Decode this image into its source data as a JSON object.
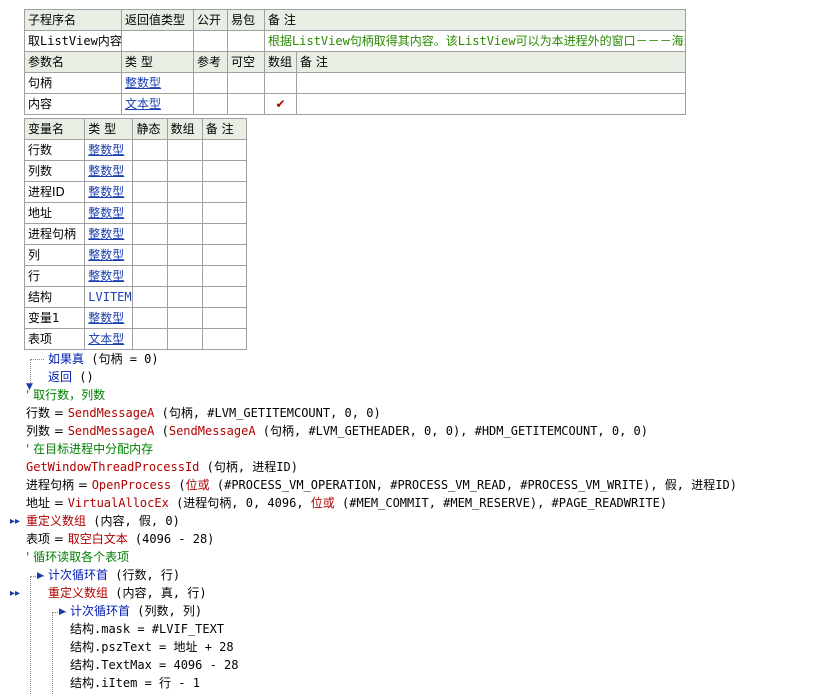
{
  "sub_table": {
    "headers": [
      "子程序名",
      "返回值类型",
      "公开",
      "易包",
      "备 注"
    ],
    "name": "取ListView内容",
    "return_type": "",
    "note": "根据ListView句柄取得其内容。该ListView可以为本进程外的窗口－－－海洋",
    "param_headers": [
      "参数名",
      "类 型",
      "参考",
      "可空",
      "数组",
      "备 注"
    ],
    "params": [
      {
        "name": "句柄",
        "type": "整数型",
        "array": ""
      },
      {
        "name": "内容",
        "type": "文本型",
        "array": "✔"
      }
    ]
  },
  "var_table": {
    "headers": [
      "变量名",
      "类 型",
      "静态",
      "数组",
      "备 注"
    ],
    "vars": [
      {
        "name": "行数",
        "type": "整数型"
      },
      {
        "name": "列数",
        "type": "整数型"
      },
      {
        "name": "进程ID",
        "type": "整数型"
      },
      {
        "name": "地址",
        "type": "整数型"
      },
      {
        "name": "进程句柄",
        "type": "整数型"
      },
      {
        "name": "列",
        "type": "整数型"
      },
      {
        "name": "行",
        "type": "整数型"
      },
      {
        "name": "结构",
        "type": "LVITEM"
      },
      {
        "name": "变量1",
        "type": "整数型"
      },
      {
        "name": "表项",
        "type": "文本型"
      }
    ]
  },
  "code": {
    "l1_kw": "如果真",
    "l1_rest": " (句柄 = 0)",
    "l2_kw": "返回",
    "l2_rest": " ()",
    "l3": "' 取行数，列数",
    "l4_a": "行数 = ",
    "l4_fn": "SendMessageA",
    "l4_rest": " (句柄, #LVM_GETITEMCOUNT, 0, 0)",
    "l5_a": "列数 = ",
    "l5_fn": "SendMessageA",
    "l5_b": " (",
    "l5_fn2": "SendMessageA",
    "l5_rest": " (句柄, #LVM_GETHEADER, 0, 0), #HDM_GETITEMCOUNT, 0, 0)",
    "l6": "' 在目标进程中分配内存",
    "l7_fn": "GetWindowThreadProcessId",
    "l7_rest": " (句柄, 进程ID)",
    "l8_a": "进程句柄 = ",
    "l8_fn": "OpenProcess",
    "l8_b": " (",
    "l8_fn2": "位或",
    "l8_rest": " (#PROCESS_VM_OPERATION, #PROCESS_VM_READ, #PROCESS_VM_WRITE), 假, 进程ID)",
    "l9_a": "地址 = ",
    "l9_fn": "VirtualAllocEx",
    "l9_b": " (进程句柄, 0, 4096, ",
    "l9_fn2": "位或",
    "l9_rest": " (#MEM_COMMIT, #MEM_RESERVE), #PAGE_READWRITE)",
    "l10_fn": "重定义数组",
    "l10_rest": " (内容, 假, 0)",
    "l11_a": "表项 = ",
    "l11_fn": "取空白文本",
    "l11_rest": " (4096 - 28)",
    "l12": "' 循环读取各个表项",
    "l13_kw": "计次循环首",
    "l13_rest": " (行数, 行)",
    "l14_fn": "重定义数组",
    "l14_rest": " (内容, 真, 行)",
    "l15_kw": "计次循环首",
    "l15_rest": " (列数, 列)",
    "l16": "结构.mask = #LVIF_TEXT",
    "l17": "结构.pszText = 地址 + 28",
    "l18": "结构.TextMax = 4096 - 28",
    "l19": "结构.iItem = 行 - 1"
  }
}
